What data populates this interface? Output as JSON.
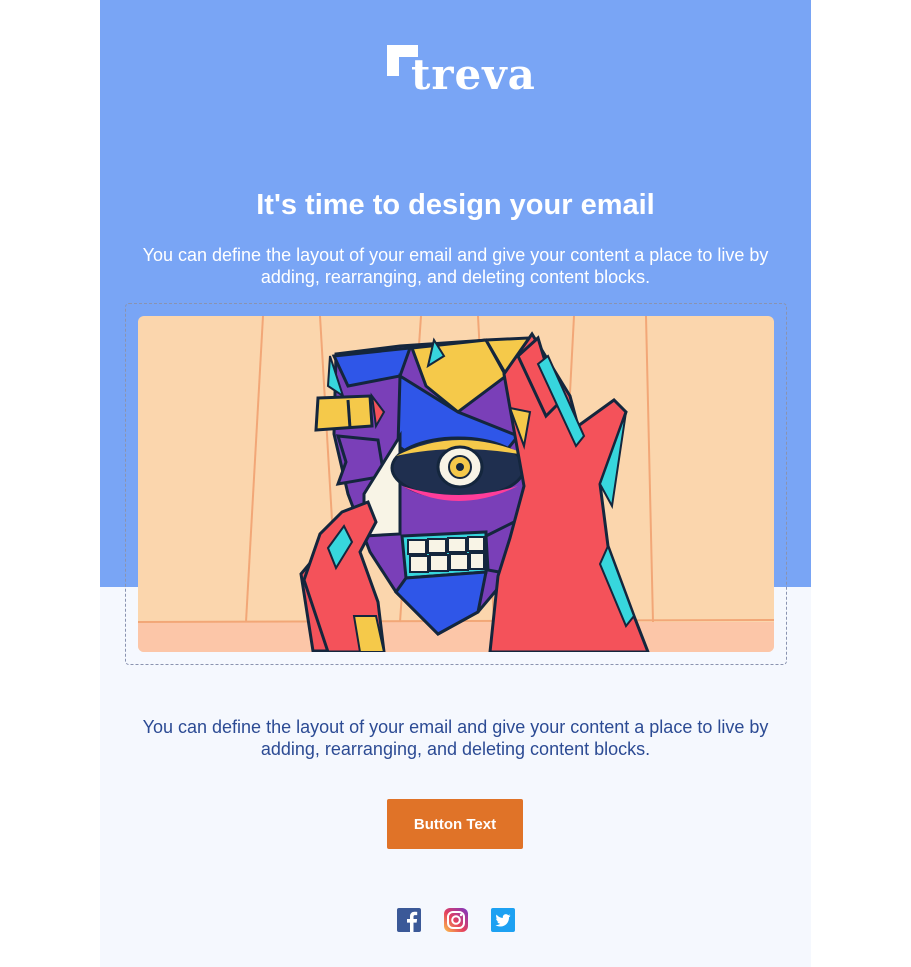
{
  "brand": {
    "name": "treva"
  },
  "hero": {
    "headline": "It's time to design your email",
    "text": "You can define the layout of your email and give your content a place to live by adding, rearranging, and deleting content blocks."
  },
  "image": {
    "icon": "abstract-face-illustration"
  },
  "body": {
    "text": "You can define the layout of your email and give your content a place to live by adding, rearranging, and deleting content blocks."
  },
  "cta": {
    "label": "Button Text"
  },
  "social": [
    {
      "icon": "facebook-icon"
    },
    {
      "icon": "instagram-icon"
    },
    {
      "icon": "twitter-icon"
    }
  ],
  "colors": {
    "hero_bg": "#79a5f5",
    "page_bg": "#f5f8fe",
    "button": "#e07328",
    "body_text": "#2c4b94"
  }
}
